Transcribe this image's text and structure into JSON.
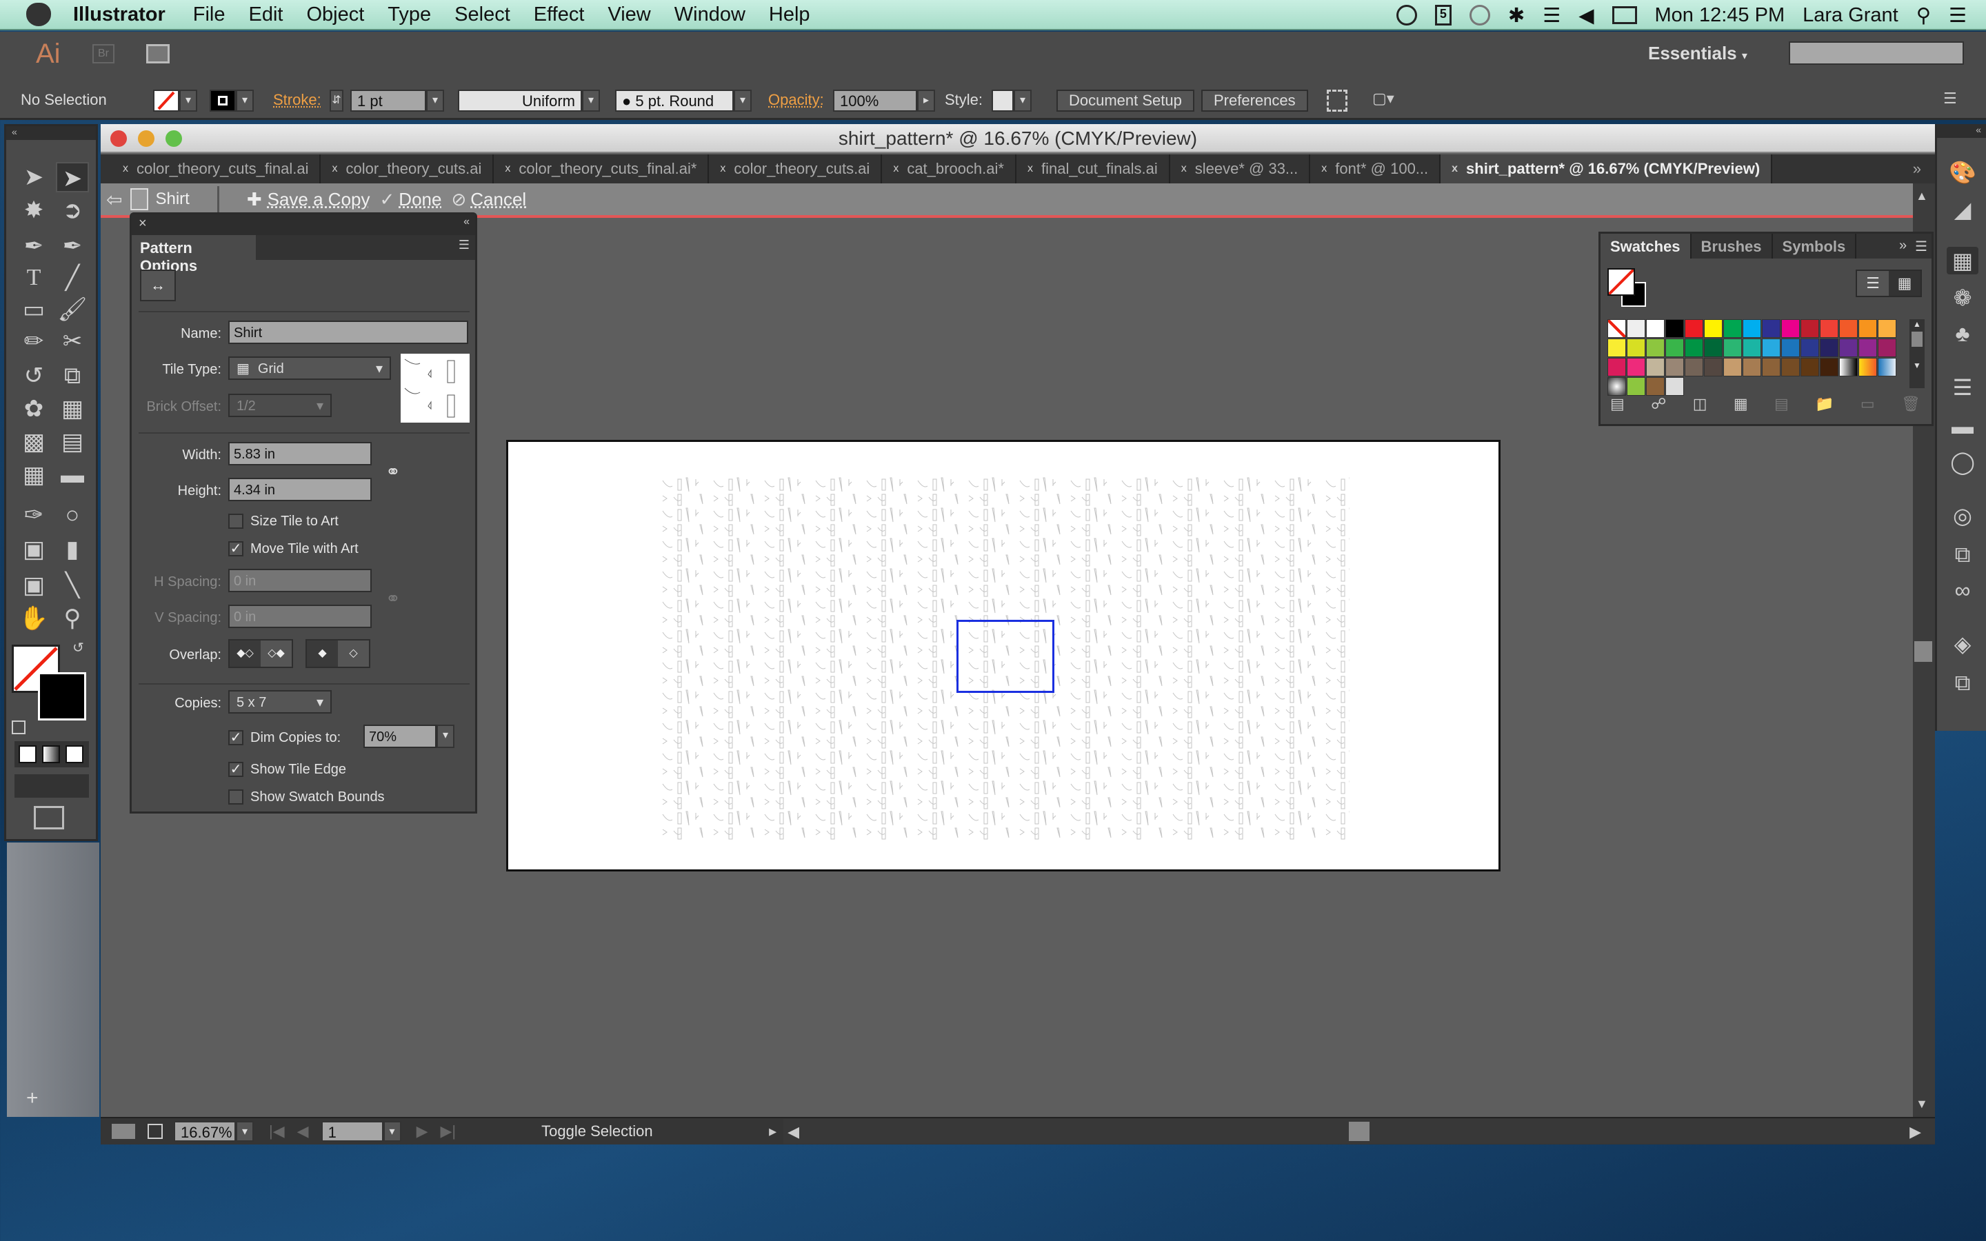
{
  "menubar": {
    "app": "Illustrator",
    "items": [
      "File",
      "Edit",
      "Object",
      "Type",
      "Select",
      "Effect",
      "View",
      "Window",
      "Help"
    ],
    "clock": "Mon 12:45 PM",
    "user": "Lara Grant"
  },
  "appbar": {
    "logo": "Ai",
    "bridge": "Br",
    "workspace": "Essentials",
    "search_placeholder": ""
  },
  "controlbar": {
    "selection": "No Selection",
    "stroke_label": "Stroke:",
    "stroke_weight": "1 pt",
    "profile": "Uniform",
    "brush": "5 pt. Round",
    "opacity_label": "Opacity:",
    "opacity": "100%",
    "style_label": "Style:",
    "document_setup": "Document Setup",
    "preferences": "Preferences"
  },
  "window": {
    "title": "shirt_pattern* @ 16.67% (CMYK/Preview)",
    "tabs": [
      {
        "label": "color_theory_cuts_final.ai",
        "active": false
      },
      {
        "label": "color_theory_cuts.ai",
        "active": false
      },
      {
        "label": "color_theory_cuts_final.ai*",
        "active": false
      },
      {
        "label": "color_theory_cuts.ai",
        "active": false
      },
      {
        "label": "cat_brooch.ai*",
        "active": false
      },
      {
        "label": "final_cut_finals.ai",
        "active": false
      },
      {
        "label": "sleeve* @ 33...",
        "active": false
      },
      {
        "label": "font* @ 100...",
        "active": false
      },
      {
        "label": "shirt_pattern* @ 16.67% (CMYK/Preview)",
        "active": true
      }
    ],
    "pattern_mode": {
      "name": "Shirt",
      "save_copy": "Save a Copy",
      "done": "Done",
      "cancel": "Cancel"
    }
  },
  "pattern_options": {
    "title": "Pattern Options",
    "name_label": "Name:",
    "name": "Shirt",
    "tile_type_label": "Tile Type:",
    "tile_type": "Grid",
    "brick_offset_label": "Brick Offset:",
    "brick_offset": "1/2",
    "width_label": "Width:",
    "width": "5.83 in",
    "height_label": "Height:",
    "height": "4.34 in",
    "size_tile_to_art": {
      "label": "Size Tile to Art",
      "checked": false
    },
    "move_tile_with_art": {
      "label": "Move Tile with Art",
      "checked": true
    },
    "h_spacing_label": "H Spacing:",
    "h_spacing": "0 in",
    "v_spacing_label": "V Spacing:",
    "v_spacing": "0 in",
    "overlap_label": "Overlap:",
    "copies_label": "Copies:",
    "copies": "5 x 7",
    "dim_copies": {
      "label": "Dim Copies to:",
      "checked": true,
      "value": "70%"
    },
    "show_tile_edge": {
      "label": "Show Tile Edge",
      "checked": true
    },
    "show_swatch_bounds": {
      "label": "Show Swatch Bounds",
      "checked": false
    }
  },
  "swatches": {
    "tabs": [
      "Swatches",
      "Brushes",
      "Symbols"
    ],
    "colors": [
      "none",
      "registration",
      "#ffffff",
      "#000000",
      "#ed1c24",
      "#fff200",
      "#00a651",
      "#00aeef",
      "#2e3192",
      "#ec008c",
      "#be1e2d",
      "#ef4136",
      "#f15a29",
      "#f7941d",
      "#fbb040",
      "#f9ed32",
      "#d7df23",
      "#8dc63f",
      "#39b54a",
      "#009444",
      "#006838",
      "#2bb673",
      "#1bb5a4",
      "#27aae1",
      "#1c75bc",
      "#2b3990",
      "#262262",
      "#662d91",
      "#92278f",
      "#9e1f63",
      "#da1c5c",
      "#ee2a7b",
      "#c2b59b",
      "#998675",
      "#736357",
      "#534741",
      "#c69c6d",
      "#a67c52",
      "#8c6239",
      "#754c24",
      "#603813",
      "#42210b",
      "gradient-bw",
      "gradient-yellow",
      "gradient-blue",
      "pattern-1",
      "pattern-2",
      "pattern-3",
      "pattern-4"
    ]
  },
  "statusbar": {
    "zoom": "16.67%",
    "artboard": "1",
    "status": "Toggle Selection"
  },
  "colors": {
    "tile_edge": "#1a2fe0",
    "pattern_mode_bar": "#e35656",
    "accent_orange": "#f0a044"
  }
}
